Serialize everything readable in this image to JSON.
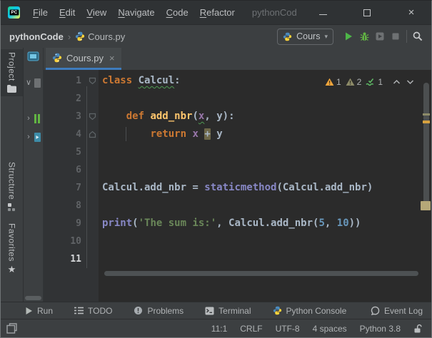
{
  "titlebar": {
    "app_logo_text": "PC",
    "menus": [
      "File",
      "Edit",
      "View",
      "Navigate",
      "Code",
      "Refactor"
    ],
    "window_title": "pythonCod"
  },
  "navbar": {
    "breadcrumb_project": "pythonCode",
    "breadcrumb_separator": "›",
    "breadcrumb_file": "Cours.py",
    "run_config_label": "Cours",
    "dropdown_arrow": "▾"
  },
  "stripes": {
    "project": "Project",
    "structure": "Structure",
    "favorites": "Favorites",
    "favorites_star": "★"
  },
  "project_panel": {
    "tree": [
      {
        "state": "expanded",
        "chevron": "∨"
      },
      {
        "state": "collapsed",
        "chevron": "›"
      },
      {
        "state": "collapsed",
        "chevron": "›"
      }
    ]
  },
  "tab": {
    "label": "Cours.py",
    "close": "×"
  },
  "editor": {
    "lines": [
      {
        "n": "1",
        "fold": "open",
        "seg": [
          {
            "t": "class",
            "c": "kw"
          },
          {
            "t": " ",
            "c": "pl"
          },
          {
            "t": "Calcul",
            "c": "pl typo"
          },
          {
            "t": ":",
            "c": "pl"
          }
        ]
      },
      {
        "n": "2",
        "seg": []
      },
      {
        "n": "3",
        "fold": "open",
        "seg": [
          {
            "t": "    ",
            "c": "pl"
          },
          {
            "t": "def",
            "c": "kw"
          },
          {
            "t": " ",
            "c": "pl"
          },
          {
            "t": "add_nbr",
            "c": "fn"
          },
          {
            "t": "(",
            "c": "pl"
          },
          {
            "t": "x",
            "c": "pm typo"
          },
          {
            "t": ", ",
            "c": "pl"
          },
          {
            "t": "y",
            "c": "pl"
          },
          {
            "t": "):",
            "c": "pl"
          }
        ]
      },
      {
        "n": "4",
        "fold": "close",
        "seg": [
          {
            "t": "        ",
            "c": "pl"
          },
          {
            "t": "return",
            "c": "kw"
          },
          {
            "t": " ",
            "c": "pl"
          },
          {
            "t": "x",
            "c": "pm"
          },
          {
            "t": " ",
            "c": "pl"
          },
          {
            "t": "+",
            "c": "pl hl"
          },
          {
            "t": " y",
            "c": "pl"
          }
        ]
      },
      {
        "n": "5",
        "seg": []
      },
      {
        "n": "6",
        "seg": []
      },
      {
        "n": "7",
        "seg": [
          {
            "t": "Calcul.add_nbr = ",
            "c": "pl"
          },
          {
            "t": "staticmethod",
            "c": "bi"
          },
          {
            "t": "(Calcul.add_nbr)",
            "c": "pl"
          }
        ]
      },
      {
        "n": "8",
        "seg": []
      },
      {
        "n": "9",
        "seg": [
          {
            "t": "print",
            "c": "bi"
          },
          {
            "t": "(",
            "c": "pl"
          },
          {
            "t": "'The sum is:'",
            "c": "st"
          },
          {
            "t": ", ",
            "c": "pl"
          },
          {
            "t": "Calcul.add_nbr(",
            "c": "pl"
          },
          {
            "t": "5",
            "c": "nu"
          },
          {
            "t": ", ",
            "c": "pl"
          },
          {
            "t": "10",
            "c": "nu"
          },
          {
            "t": "))",
            "c": "pl"
          }
        ]
      },
      {
        "n": "10",
        "seg": []
      },
      {
        "n": "11",
        "current": true,
        "seg": []
      }
    ],
    "inspections": [
      {
        "severity": "warning",
        "count": "1"
      },
      {
        "severity": "weak-warning",
        "count": "2"
      },
      {
        "severity": "typo",
        "count": "1"
      }
    ]
  },
  "bottom_toolbar": {
    "items": [
      "Run",
      "TODO",
      "Problems",
      "Terminal",
      "Python Console",
      "Event Log"
    ]
  },
  "statusbar": {
    "caret_position": "11:1",
    "line_separator": "CRLF",
    "encoding": "UTF-8",
    "indent": "4 spaces",
    "interpreter": "Python 3.8"
  },
  "colors": {
    "editor_background": "#2b2b2b",
    "panel_background": "#3c3f41",
    "tab_underline_blue": "#3e7cbd",
    "keyword_orange": "#cc7832",
    "function_yellow": "#ffc66d",
    "builtin_purple_blue": "#8888c6",
    "string_green": "#6a8759",
    "number_blue": "#6897bb",
    "param_purple": "#9876aa",
    "run_green": "#4db548",
    "bug_green": "#62b543",
    "warning_yellow": "#f2a63c",
    "weak_warning_olive": "#8d8b68"
  }
}
